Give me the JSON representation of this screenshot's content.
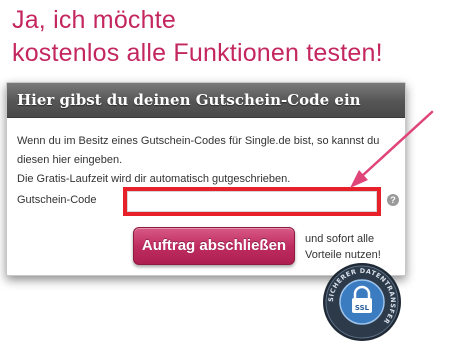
{
  "headline": {
    "line1": "Ja, ich möchte",
    "line2": "kostenlos alle Funktionen testen!"
  },
  "panel": {
    "title": "Hier gibst du deinen Gutschein-Code ein",
    "paragraph1": "Wenn du im Besitz eines Gutschein-Codes für Single.de bist, so kannst du diesen hier eingeben.",
    "paragraph2": "Die Gratis-Laufzeit wird dir automatisch gutgeschrieben.",
    "code_label": "Gutschein-Code",
    "code_value": "",
    "code_placeholder": "",
    "help_symbol": "?",
    "order_button": "Auftrag abschließen",
    "side_text": "und sofort alle Vorteile nutzen!"
  },
  "seal": {
    "center_text": "SSL",
    "ring_text": "SICHERER DATENTRANSFER"
  },
  "colors": {
    "accent": "#c4275f",
    "highlight": "#e8202a",
    "arrow": "#e0457a"
  },
  "icons": {
    "help": "question-mark-icon",
    "lock": "padlock-icon"
  }
}
